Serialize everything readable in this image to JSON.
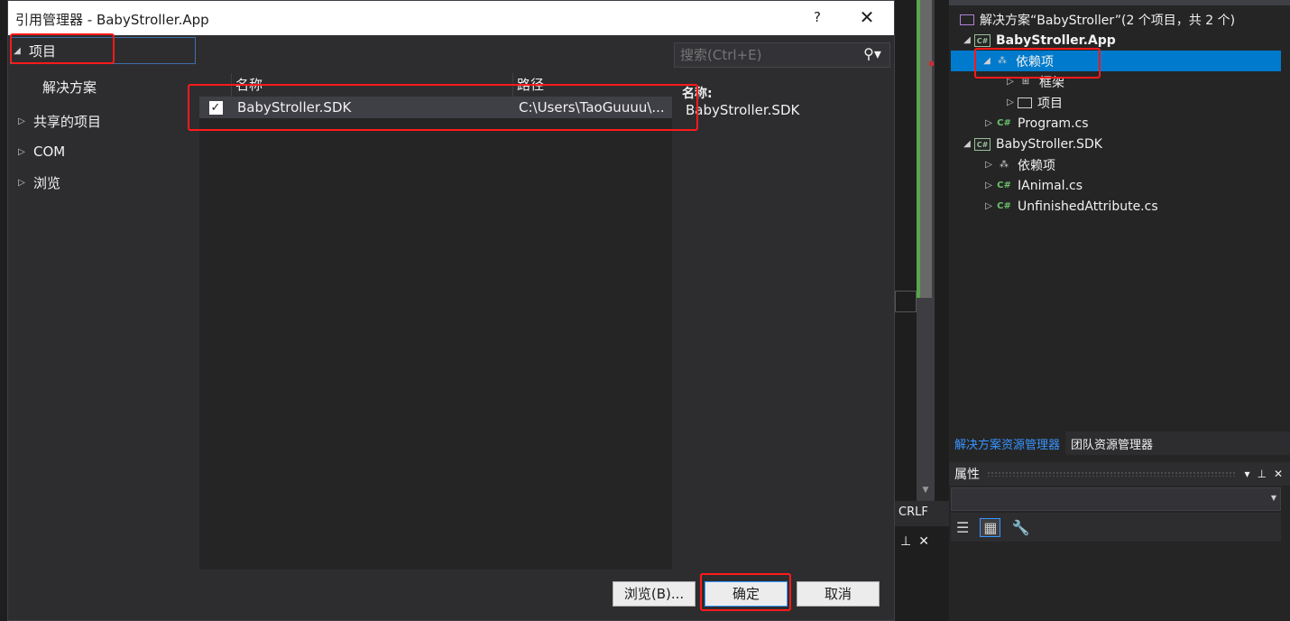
{
  "dialog": {
    "title": "引用管理器 - BabyStroller.App",
    "help_label": "?",
    "close_label": "✕",
    "categories": [
      {
        "label": "项目",
        "expanded": true
      },
      {
        "label": "解决方案"
      },
      {
        "label": "共享的项目",
        "expanded": false
      },
      {
        "label": "COM",
        "expanded": false
      },
      {
        "label": "浏览",
        "expanded": false
      }
    ],
    "search": {
      "placeholder": "搜索(Ctrl+E)",
      "icon": "search-icon"
    },
    "columns": {
      "name": "名称",
      "path": "路径"
    },
    "rows": [
      {
        "checked": true,
        "check_glyph": "✓",
        "name": "BabyStroller.SDK",
        "path": "C:\\Users\\TaoGuuuu\\..."
      }
    ],
    "details": {
      "name_label": "名称:",
      "name_value": "BabyStroller.SDK"
    },
    "buttons": {
      "browse": "浏览(B)...",
      "ok": "确定",
      "cancel": "取消"
    }
  },
  "solution_explorer": {
    "items": [
      {
        "label": "解决方案“BabyStroller”(2 个项目，共 2 个)",
        "icon": "solution-icon"
      },
      {
        "label": "BabyStroller.App",
        "icon": "csharp-project-icon",
        "bold": true
      },
      {
        "label": "依赖项",
        "icon": "dependencies-icon",
        "selected": true
      },
      {
        "label": "框架",
        "icon": "framework-icon"
      },
      {
        "label": "项目",
        "icon": "project-folder-icon"
      },
      {
        "label": "Program.cs",
        "icon": "csharp-file-icon"
      },
      {
        "label": "BabyStroller.SDK",
        "icon": "csharp-project-icon"
      },
      {
        "label": "依赖项",
        "icon": "dependencies-icon"
      },
      {
        "label": "IAnimal.cs",
        "icon": "csharp-file-icon"
      },
      {
        "label": "UnfinishedAttribute.cs",
        "icon": "csharp-file-icon"
      }
    ],
    "tabs": [
      "解决方案资源管理器",
      "团队资源管理器"
    ]
  },
  "properties": {
    "title": "属性"
  },
  "status": {
    "line_ending": "CRLF"
  },
  "colors": {
    "accent": "#007acc",
    "highlight": "#ff1a1a",
    "csharp": "#6ac36a"
  }
}
